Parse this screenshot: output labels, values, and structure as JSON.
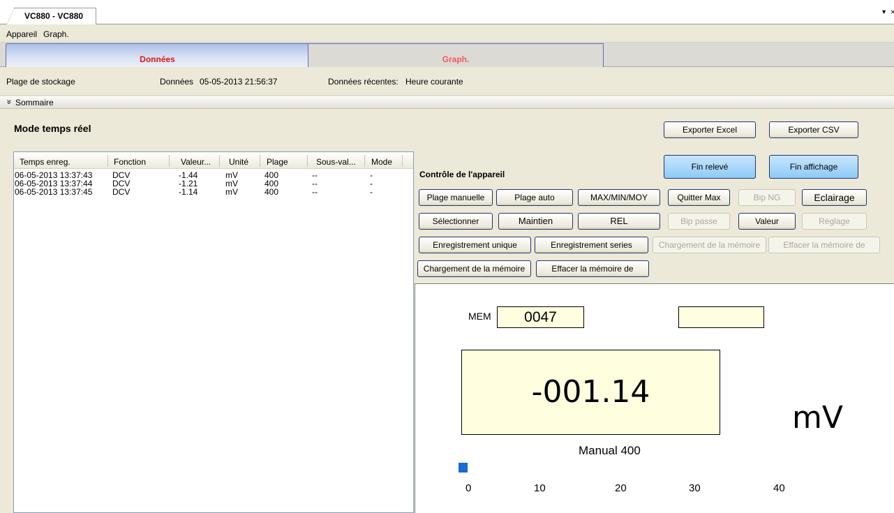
{
  "window": {
    "doc_tab": "VC880 - VC880",
    "dropdown_icon": "▼",
    "close_icon": "×"
  },
  "menu": [
    "Appareil",
    "Graph."
  ],
  "tabs": {
    "donnees": "Données",
    "graph": "Graph."
  },
  "storage": {
    "label": "Plage de stockage",
    "data_label": "Données",
    "data_value": "05-05-2013 21:56:37",
    "recent_label": "Données récentes:",
    "recent_value": "Heure courante"
  },
  "summary": {
    "label": "Sommaire",
    "icon": "»"
  },
  "realtime": {
    "title": "Mode temps réel"
  },
  "export": {
    "excel": "Exporter Excel",
    "csv": "Exporter CSV"
  },
  "table": {
    "columns": [
      "Temps enreg.",
      "Fonction",
      "Valeur...",
      "Unité",
      "Plage",
      "Sous-val...",
      "Mode"
    ],
    "rows": [
      [
        "06-05-2013 13:37:43",
        "DCV",
        "-1.44",
        "mV",
        "400",
        "--",
        "-"
      ],
      [
        "06-05-2013 13:37:44",
        "DCV",
        "-1.21",
        "mV",
        "400",
        "--",
        "-"
      ],
      [
        "06-05-2013 13:37:45",
        "DCV",
        "-1.14",
        "mV",
        "400",
        "--",
        "-"
      ]
    ]
  },
  "control": {
    "title": "Contrôle de l'appareil",
    "fin_releve": "Fin relevé",
    "fin_affichage": "Fin affichage",
    "row1": [
      "Plage manuelle",
      "Plage auto",
      "MAX/MIN/MOY",
      "Quitter Max",
      "Bip NG",
      "Eclairage"
    ],
    "row2": [
      "Sélectionner",
      "Maintien",
      "REL",
      "Bip passe",
      "Valeur",
      "Réglage"
    ],
    "row3": [
      "Enregistrement unique",
      "Enregistrement series",
      "Chargement de la mémoire",
      "Effacer la mémoire de"
    ],
    "row4": [
      "Chargement de la mémoire",
      "Effacer la mémoire de"
    ]
  },
  "display": {
    "mem_label": "MEM",
    "mem_value": "0047",
    "secondary_value": "",
    "reading": "-001.14",
    "unit": "mV",
    "mode": "Manual  400",
    "scale": [
      "0",
      "10",
      "20",
      "30",
      "40"
    ],
    "bar_level": 1.14
  }
}
